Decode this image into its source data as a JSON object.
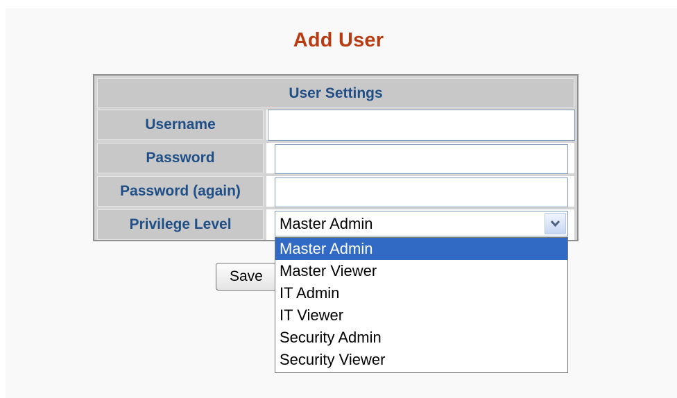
{
  "page": {
    "title": "Add User"
  },
  "user_settings": {
    "header": "User Settings",
    "fields": [
      {
        "label": "Username",
        "value": ""
      },
      {
        "label": "Password",
        "value": ""
      },
      {
        "label": "Password (again)",
        "value": ""
      },
      {
        "label": "Privilege Level",
        "value": "Master Admin"
      }
    ]
  },
  "privilege_dropdown": {
    "selected": "Master Admin",
    "options": [
      "Master Admin",
      "Master Viewer",
      "IT Admin",
      "IT Viewer",
      "Security Admin",
      "Security Viewer"
    ],
    "highlighted_index": 0
  },
  "actions": {
    "save_label": "Save"
  },
  "colors": {
    "title": "#b93b12",
    "label_text": "#1f4f86",
    "label_bg": "#c8c8c8",
    "selection_bg": "#316ac5"
  },
  "icons": {
    "select_arrow": "chevron-down-icon"
  }
}
